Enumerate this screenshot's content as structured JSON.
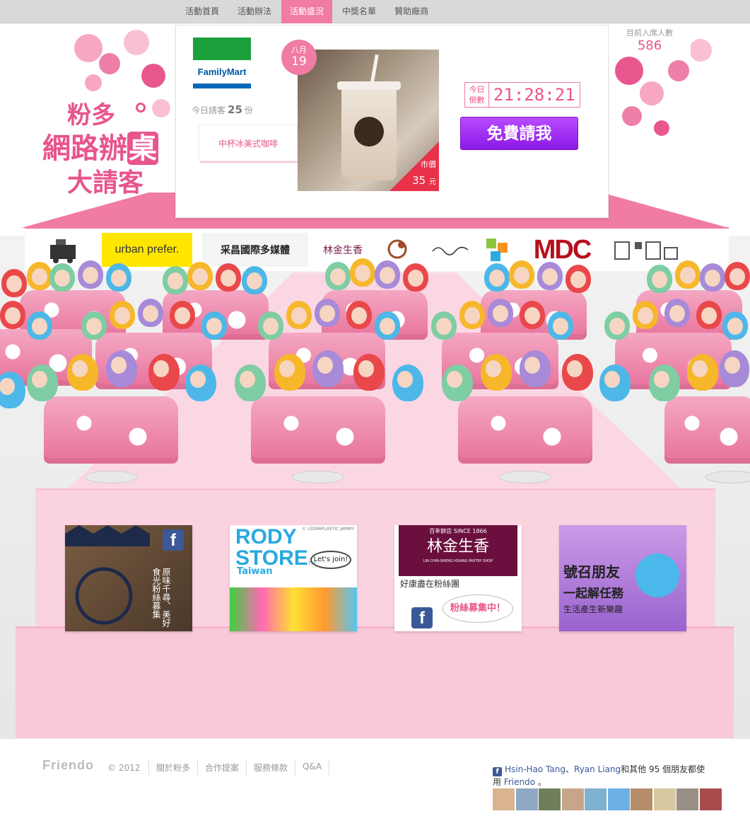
{
  "nav": {
    "items": [
      {
        "label": "活動首頁",
        "active": false
      },
      {
        "label": "活動辦法",
        "active": false
      },
      {
        "label": "活動盛況",
        "active": true
      },
      {
        "label": "中獎名單",
        "active": false
      },
      {
        "label": "贊助廠商",
        "active": false
      }
    ]
  },
  "logo": {
    "line1": "粉多",
    "line2a": "網路",
    "line2b": "辦",
    "line2c": "桌",
    "line3": "大請客"
  },
  "attendance": {
    "label": "目前入席人數",
    "value": "586"
  },
  "product": {
    "store_logo_text": "FamilyMart",
    "invite_prefix": "今日請客",
    "invite_count": "25",
    "invite_suffix": "份",
    "item_name": "中杯冰美式咖啡",
    "date_month": "八月",
    "date_day": "19",
    "price_label": "市價",
    "price_value": "35",
    "price_unit": "元",
    "countdown_label": "今日 倒數",
    "countdown_time": "21:28:21",
    "cta_label": "免費請我"
  },
  "sponsors": [
    {
      "name": "urban prefer.",
      "icon": "urban-prefer-logo"
    },
    {
      "name": "采昌國際多媒體",
      "icon": "caichang-logo"
    },
    {
      "name": "林金生香",
      "icon": "linjinshengxiang-logo"
    },
    {
      "name": "MDC",
      "icon": "mdc-logo"
    }
  ],
  "fanboxes": {
    "box1": {
      "text": "原味千尋、美好食光粉絲募集"
    },
    "box2": {
      "title": "RODY STORE",
      "tm": "TM",
      "subtitle": "Taiwan",
      "bubble": "Let's join!",
      "copyright": "© LEDRAPLASTIC  JAMMY"
    },
    "box3": {
      "since": "百年餅店 SINCE 1866",
      "name": "林金生香",
      "english": "LIN CHIN-SHENG HSIANG PASTRY SHOP",
      "sub": "好康盡在粉絲團",
      "bubble": "粉絲募集中！"
    },
    "box4": {
      "line1": "號召朋友",
      "line2": "一起解任務",
      "line3": "生活產生新樂趣"
    }
  },
  "footer": {
    "brand": "Friendo",
    "copyright": "© 2012",
    "links": [
      "關於粉多",
      "合作提案",
      "服務條款",
      "Q&A"
    ],
    "friend1": "Hsin-Hao Tang",
    "sep": "、",
    "friend2": "Ryan Liang",
    "friends_suffix": "和其他 95 個朋友都使用",
    "app": "Friendo",
    "end": "。"
  },
  "colors": {
    "accent": "#f07ba4",
    "brand_pink": "#e8558c",
    "cta_purple": "#8b18e6",
    "facebook": "#3b5998"
  }
}
